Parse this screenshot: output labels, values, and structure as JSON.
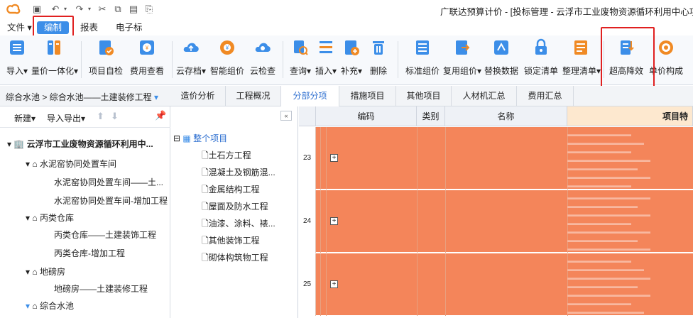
{
  "title": "广联达预算计价 - [投标管理 - 云浮市工业废物资源循环利用中心项",
  "menu": {
    "file": "文件",
    "edit": "编制",
    "report": "报表",
    "etender": "电子标"
  },
  "ribbon": [
    {
      "label": "导入",
      "icon": "import-icon",
      "dropdown": true
    },
    {
      "label": "量价一体化",
      "icon": "quantity-price-icon",
      "dropdown": true
    },
    {
      "label": "项目自检",
      "icon": "self-check-icon"
    },
    {
      "label": "费用查看",
      "icon": "fee-view-icon"
    },
    {
      "label": "云存档",
      "icon": "cloud-save-icon",
      "dropdown": true
    },
    {
      "label": "智能组价",
      "icon": "smart-pricing-icon"
    },
    {
      "label": "云检查",
      "icon": "cloud-check-icon"
    },
    {
      "label": "查询",
      "icon": "query-icon",
      "dropdown": true
    },
    {
      "label": "插入",
      "icon": "insert-icon",
      "dropdown": true
    },
    {
      "label": "补充",
      "icon": "supplement-icon",
      "dropdown": true
    },
    {
      "label": "删除",
      "icon": "delete-icon"
    },
    {
      "label": "标准组价",
      "icon": "standard-pricing-icon"
    },
    {
      "label": "复用组价",
      "icon": "reuse-pricing-icon",
      "dropdown": true
    },
    {
      "label": "替换数据",
      "icon": "replace-data-icon"
    },
    {
      "label": "锁定清单",
      "icon": "lock-list-icon"
    },
    {
      "label": "整理清单",
      "icon": "organize-list-icon",
      "dropdown": true
    },
    {
      "label": "超高降效",
      "icon": "high-rise-icon"
    },
    {
      "label": "单价构成",
      "icon": "unit-price-icon"
    }
  ],
  "breadcrumb": "综合水池 > 综合水池——土建装修工程",
  "tabs": [
    "造价分析",
    "工程概况",
    "分部分项",
    "措施项目",
    "其他项目",
    "人材机汇总",
    "费用汇总"
  ],
  "left_toolbar": {
    "new": "新建",
    "import_export": "导入导出"
  },
  "tree": [
    {
      "label": "云浮市工业废物资源循环利用中...",
      "level": 0
    },
    {
      "label": "水泥窑协同处置车间",
      "level": 1
    },
    {
      "label": "水泥窑协同处置车间——土...",
      "level": 2
    },
    {
      "label": "水泥窑协同处置车间-增加工程",
      "level": 2
    },
    {
      "label": "丙类仓库",
      "level": 1
    },
    {
      "label": "丙类仓库——土建装饰工程",
      "level": 2
    },
    {
      "label": "丙类仓库-增加工程",
      "level": 2
    },
    {
      "label": "地磅房",
      "level": 1
    },
    {
      "label": "地磅房——土建装修工程",
      "level": 2
    },
    {
      "label": "综合水池",
      "level": 1
    }
  ],
  "mid_tree": {
    "root": "整个项目",
    "items": [
      "土石方工程",
      "混凝土及钢筋混...",
      "金属结构工程",
      "屋面及防水工程",
      "油漆、涂料、裱...",
      "其他装饰工程",
      "砌体构筑物工程"
    ]
  },
  "grid": {
    "headers": [
      "编码",
      "类别",
      "名称",
      "项目特征"
    ],
    "rows": [
      {
        "num": "23"
      },
      {
        "num": "24"
      },
      {
        "num": "25"
      }
    ]
  },
  "colors": {
    "accent": "#3c8ee8",
    "row_highlight": "#f4855a",
    "highlight_box": "#e02020"
  }
}
